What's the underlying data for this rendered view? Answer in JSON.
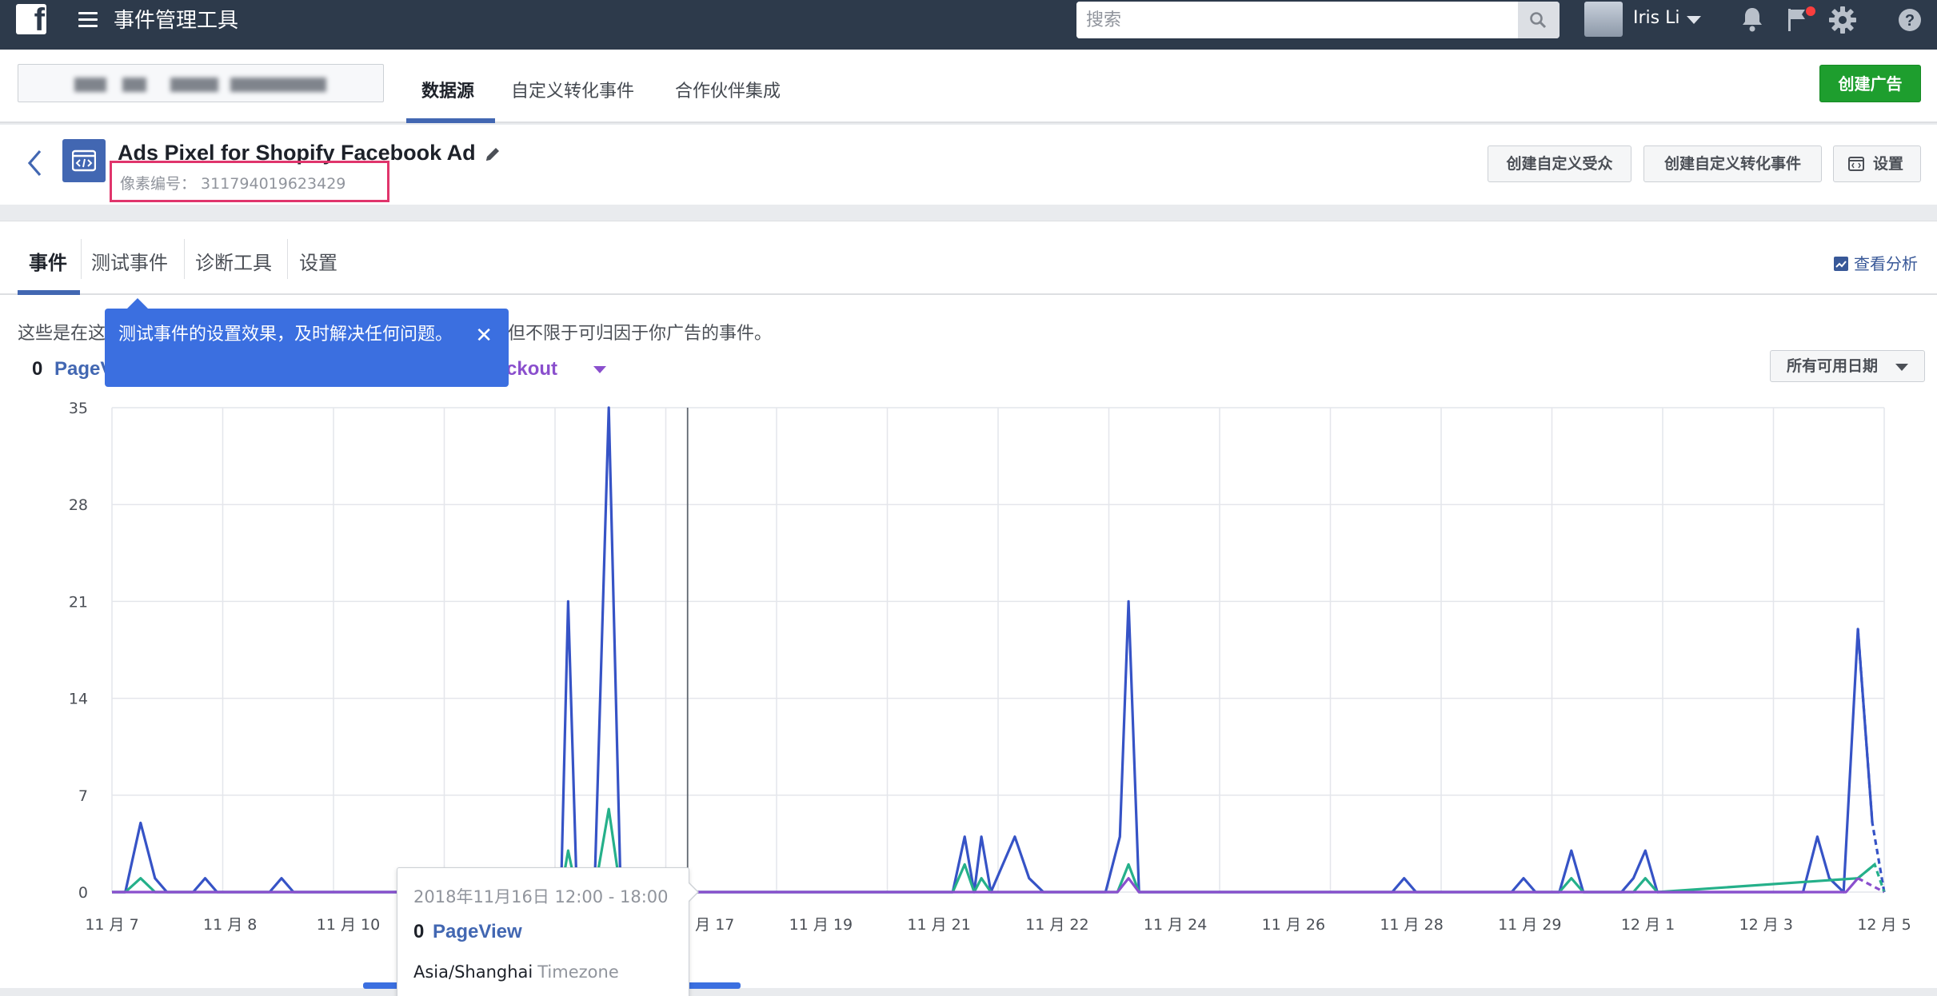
{
  "topbar": {
    "logo_glyph": "f",
    "app_title": "事件管理工具",
    "search_placeholder": "搜索",
    "user_name": "Iris Li",
    "icons": [
      "menu-icon",
      "search-icon",
      "bell-icon",
      "flag-icon",
      "gear-icon",
      "help-icon"
    ]
  },
  "subnav": {
    "tabs": [
      "数据源",
      "自定义转化事件",
      "合作伙伴集成"
    ],
    "active_tab": "数据源",
    "create_ad_label": "创建广告"
  },
  "pixel": {
    "name": "Ads Pixel for Shopify Facebook Ad",
    "id_text": "像素编号： 311794019623429",
    "buttons": [
      "创建自定义受众",
      "创建自定义转化事件",
      "设置"
    ]
  },
  "tabs": {
    "items": [
      "事件",
      "测试事件",
      "诊断工具",
      "设置"
    ],
    "active": "事件",
    "view_analysis": "查看分析"
  },
  "content": {
    "description": "这些是在这  但不限于可归因于你广告的事件。",
    "desc_left": "这些是在这",
    "desc_right": "但不限于可归因于你广告的事件。",
    "stat_count": "0",
    "stat_pageview": "PageV",
    "stat_checkout": "heckout",
    "date_filter": "所有可用日期"
  },
  "coachmark": {
    "text": "测试事件的设置效果，及时解决任何问题。",
    "close": "✕"
  },
  "hover_card": {
    "time": "2018年11月16日 12:00 - 18:00",
    "count": "0",
    "event": "PageView",
    "tz_name": "Asia/Shanghai",
    "tz_label": "Timezone"
  },
  "colors": {
    "pageview": "#3653c6",
    "green_series": "#25b08a",
    "checkout": "#8a4fcd",
    "brand": "#4267b2",
    "create_ad": "#1e9e2e",
    "highlight_box": "#e0356c"
  },
  "chart_data": {
    "type": "line",
    "y_ticks": [
      0,
      7,
      14,
      21,
      28,
      35
    ],
    "ylim": [
      0,
      35
    ],
    "x_tick_labels": [
      "11 月 7",
      "11 月 8",
      "11 月 10",
      "",
      "",
      "11 月 17",
      "11 月 19",
      "11 月 21",
      "11 月 22",
      "11 月 24",
      "11 月 26",
      "11 月 28",
      "11 月 29",
      "12 月 1",
      "12 月 3",
      "12 月 5"
    ],
    "grid": true,
    "series": [
      {
        "name": "PageView",
        "color": "#3653c6",
        "points": [
          [
            0,
            0
          ],
          [
            0.28,
            0
          ],
          [
            0.6,
            5
          ],
          [
            0.9,
            1
          ],
          [
            1.15,
            0
          ],
          [
            1.7,
            0
          ],
          [
            1.95,
            1
          ],
          [
            2.2,
            0
          ],
          [
            3,
            0
          ],
          [
            3.3,
            0
          ],
          [
            3.55,
            1
          ],
          [
            3.8,
            0
          ],
          [
            4.8,
            0
          ],
          [
            5.0,
            0
          ],
          [
            5.2,
            0
          ],
          [
            9.4,
            0
          ],
          [
            9.55,
            21
          ],
          [
            9.73,
            0
          ],
          [
            10.1,
            0
          ],
          [
            10.4,
            35
          ],
          [
            10.65,
            0
          ],
          [
            11.0,
            0
          ],
          [
            17.6,
            0
          ],
          [
            17.85,
            4
          ],
          [
            18.05,
            0
          ],
          [
            18.2,
            4
          ],
          [
            18.4,
            0
          ],
          [
            18.9,
            4
          ],
          [
            19.2,
            1
          ],
          [
            19.5,
            0
          ],
          [
            20.8,
            0
          ],
          [
            21.1,
            4
          ],
          [
            21.28,
            21
          ],
          [
            21.5,
            0
          ],
          [
            26.8,
            0
          ],
          [
            27.05,
            1
          ],
          [
            27.3,
            0
          ],
          [
            29.3,
            0
          ],
          [
            29.55,
            1
          ],
          [
            29.8,
            0
          ],
          [
            30.3,
            0
          ],
          [
            30.55,
            3
          ],
          [
            30.8,
            0
          ],
          [
            31.6,
            0
          ],
          [
            31.85,
            1
          ],
          [
            32.1,
            3
          ],
          [
            32.35,
            0
          ],
          [
            35.4,
            0
          ],
          [
            35.7,
            4
          ],
          [
            35.95,
            1
          ],
          [
            36.25,
            0
          ],
          [
            36.55,
            19
          ],
          [
            36.85,
            5
          ],
          [
            37.1,
            0
          ]
        ]
      },
      {
        "name": "",
        "color": "#25b08a",
        "points": [
          [
            0,
            0
          ],
          [
            0.28,
            0
          ],
          [
            0.6,
            1
          ],
          [
            0.9,
            0
          ],
          [
            9.4,
            0
          ],
          [
            9.55,
            3
          ],
          [
            9.73,
            0
          ],
          [
            10.1,
            0
          ],
          [
            10.4,
            6
          ],
          [
            10.65,
            0
          ],
          [
            17.6,
            0
          ],
          [
            17.85,
            2
          ],
          [
            18.05,
            0
          ],
          [
            18.2,
            1
          ],
          [
            18.4,
            0
          ],
          [
            21.05,
            0
          ],
          [
            21.28,
            2
          ],
          [
            21.5,
            0
          ],
          [
            30.3,
            0
          ],
          [
            30.55,
            1
          ],
          [
            30.8,
            0
          ],
          [
            31.85,
            0
          ],
          [
            32.1,
            1
          ],
          [
            32.35,
            0
          ],
          [
            36.55,
            1
          ],
          [
            36.9,
            2
          ],
          [
            37.1,
            0
          ]
        ]
      },
      {
        "name": "Checkout",
        "color": "#8a4fcd",
        "points": [
          [
            0,
            0
          ],
          [
            21.05,
            0
          ],
          [
            21.28,
            1
          ],
          [
            21.5,
            0
          ],
          [
            36.3,
            0
          ],
          [
            36.55,
            1
          ],
          [
            37.1,
            0
          ]
        ]
      }
    ],
    "hover_x": 12.05
  }
}
